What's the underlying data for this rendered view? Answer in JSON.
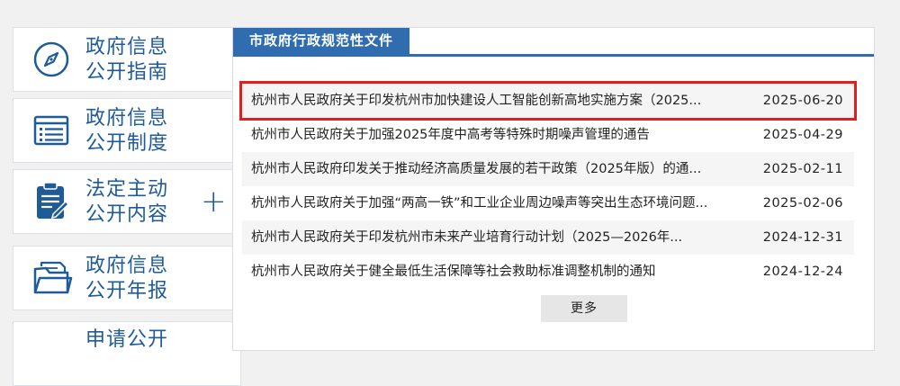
{
  "sidebar": {
    "items": [
      {
        "line1": "政府信息",
        "line2": "公开指南",
        "icon": "compass-icon"
      },
      {
        "line1": "政府信息",
        "line2": "公开制度",
        "icon": "document-list-icon"
      },
      {
        "line1": "法定主动",
        "line2": "公开内容",
        "icon": "clipboard-edit-icon",
        "expand": "+"
      },
      {
        "line1": "政府信息",
        "line2": "公开年报",
        "icon": "folder-icon"
      },
      {
        "line1": "申请公开",
        "line2": "",
        "icon": ""
      }
    ]
  },
  "panel": {
    "tab_label": "市政府行政规范性文件",
    "more_label": "更多",
    "documents": [
      {
        "title": "杭州市人民政府关于印发杭州市加快建设人工智能创新高地实施方案（2025...",
        "date": "2025-06-20"
      },
      {
        "title": "杭州市人民政府关于加强2025年度中高考等特殊时期噪声管理的通告",
        "date": "2025-04-29"
      },
      {
        "title": "杭州市人民政府印发关于推动经济高质量发展的若干政策（2025年版）的通...",
        "date": "2025-02-11"
      },
      {
        "title": "杭州市人民政府关于加强“两高一铁”和工业企业周边噪声等突出生态环境问题...",
        "date": "2025-02-06"
      },
      {
        "title": "杭州市人民政府关于印发杭州市未来产业培育行动计划（2025—2026年...",
        "date": "2024-12-31"
      },
      {
        "title": "杭州市人民政府关于健全最低生活保障等社会救助标准调整机制的通知",
        "date": "2024-12-24"
      }
    ]
  },
  "colors": {
    "accent": "#2f6db0",
    "sidebar_text": "#1f5a99",
    "highlight": "#e02020"
  }
}
